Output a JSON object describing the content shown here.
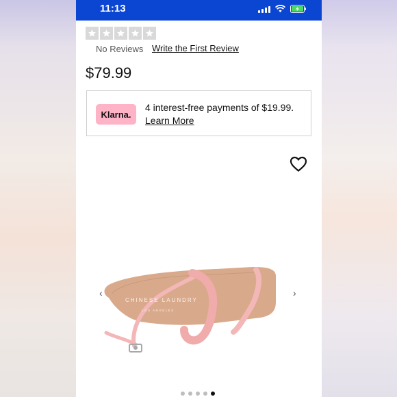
{
  "status_bar": {
    "time": "11:13"
  },
  "reviews": {
    "no_reviews": "No Reviews",
    "write_first": "Write the First Review",
    "rating_stars": 0
  },
  "product": {
    "price": "$79.99",
    "image_brand_text": "CHINESE LAUNDRY",
    "image_brand_sub": "LOS ANGELES"
  },
  "klarna": {
    "badge": "Klarna.",
    "message": "4 interest-free payments of $19.99.",
    "learn_more": "Learn More",
    "badge_color": "#ffb3c7"
  },
  "carousel": {
    "prev_icon": "‹",
    "next_icon": "›",
    "total_images": 5,
    "active_index": 4
  },
  "colors": {
    "status_bar": "#0b46d3",
    "strap": "#f2b7b6",
    "footbed": "#d9a98b"
  }
}
